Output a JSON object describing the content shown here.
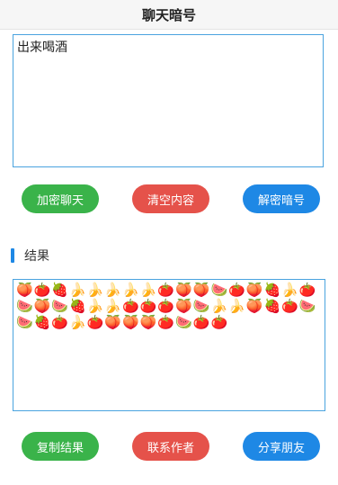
{
  "header": {
    "title": "聊天暗号"
  },
  "input": {
    "value": "出来喝酒"
  },
  "actions_top": {
    "encrypt_label": "加密聊天",
    "clear_label": "清空内容",
    "decrypt_label": "解密暗号"
  },
  "result": {
    "section_label": "结果",
    "value": "🍑🍅🍓🍌🍌🍌🍌🍌🍅🍑🍑🍉🍅🍑🍓🍌🍅🍉🍑🍉🍓🍌🍌🍅🍅🍅🍑🍉🍌🍌🍑🍓🍅🍉🍉🍓🍅🍌🍅🍑🍑🍑🍅🍉🍅🍅"
  },
  "actions_bottom": {
    "copy_label": "复制结果",
    "contact_label": "联系作者",
    "share_label": "分享朋友"
  },
  "colors": {
    "green": "#3ab34a",
    "red": "#e5524a",
    "blue": "#1e88e5",
    "border": "#4aa3df"
  }
}
